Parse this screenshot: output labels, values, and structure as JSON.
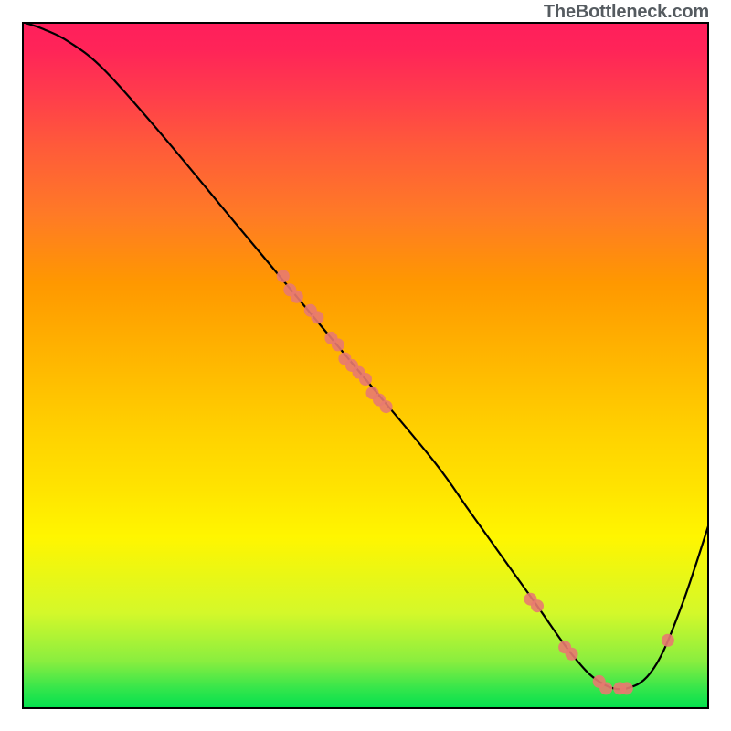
{
  "watermark": "TheBottleneck.com",
  "chart_data": {
    "type": "line",
    "title": "",
    "xlabel": "",
    "ylabel": "",
    "xlim": [
      0,
      100
    ],
    "ylim": [
      0,
      100
    ],
    "grid": false,
    "legend": false,
    "series": [
      {
        "name": "bottleneck-curve",
        "type": "line",
        "color": "#000000",
        "x": [
          0,
          3,
          7,
          12,
          20,
          30,
          40,
          50,
          60,
          65,
          70,
          75,
          80,
          84,
          88,
          92,
          96,
          100
        ],
        "values": [
          100,
          99,
          97,
          93,
          84,
          72,
          60,
          48,
          36,
          29,
          22,
          15,
          8,
          4,
          3,
          6,
          15,
          27
        ]
      },
      {
        "name": "marker-cluster-upper",
        "type": "scatter",
        "color": "#e87a70",
        "x": [
          38,
          39,
          40,
          42,
          43,
          45,
          46,
          47,
          48,
          49,
          50,
          51,
          52,
          53
        ],
        "values": [
          63,
          61,
          60,
          58,
          57,
          54,
          53,
          51,
          50,
          49,
          48,
          46,
          45,
          44
        ]
      },
      {
        "name": "marker-cluster-minimum",
        "type": "scatter",
        "color": "#e87a70",
        "x": [
          74,
          75,
          79,
          80,
          84,
          85,
          87,
          88
        ],
        "values": [
          16,
          15,
          9,
          8,
          4,
          3,
          3,
          3
        ]
      },
      {
        "name": "marker-cluster-right",
        "type": "scatter",
        "color": "#e87a70",
        "x": [
          94
        ],
        "values": [
          10
        ]
      }
    ],
    "gradient_background": {
      "direction": "vertical",
      "stops": [
        {
          "pos": 0.0,
          "color": "#00e04f"
        },
        {
          "pos": 0.25,
          "color": "#fff600"
        },
        {
          "pos": 0.62,
          "color": "#ff9800"
        },
        {
          "pos": 1.0,
          "color": "#ff1f5c"
        }
      ]
    }
  }
}
